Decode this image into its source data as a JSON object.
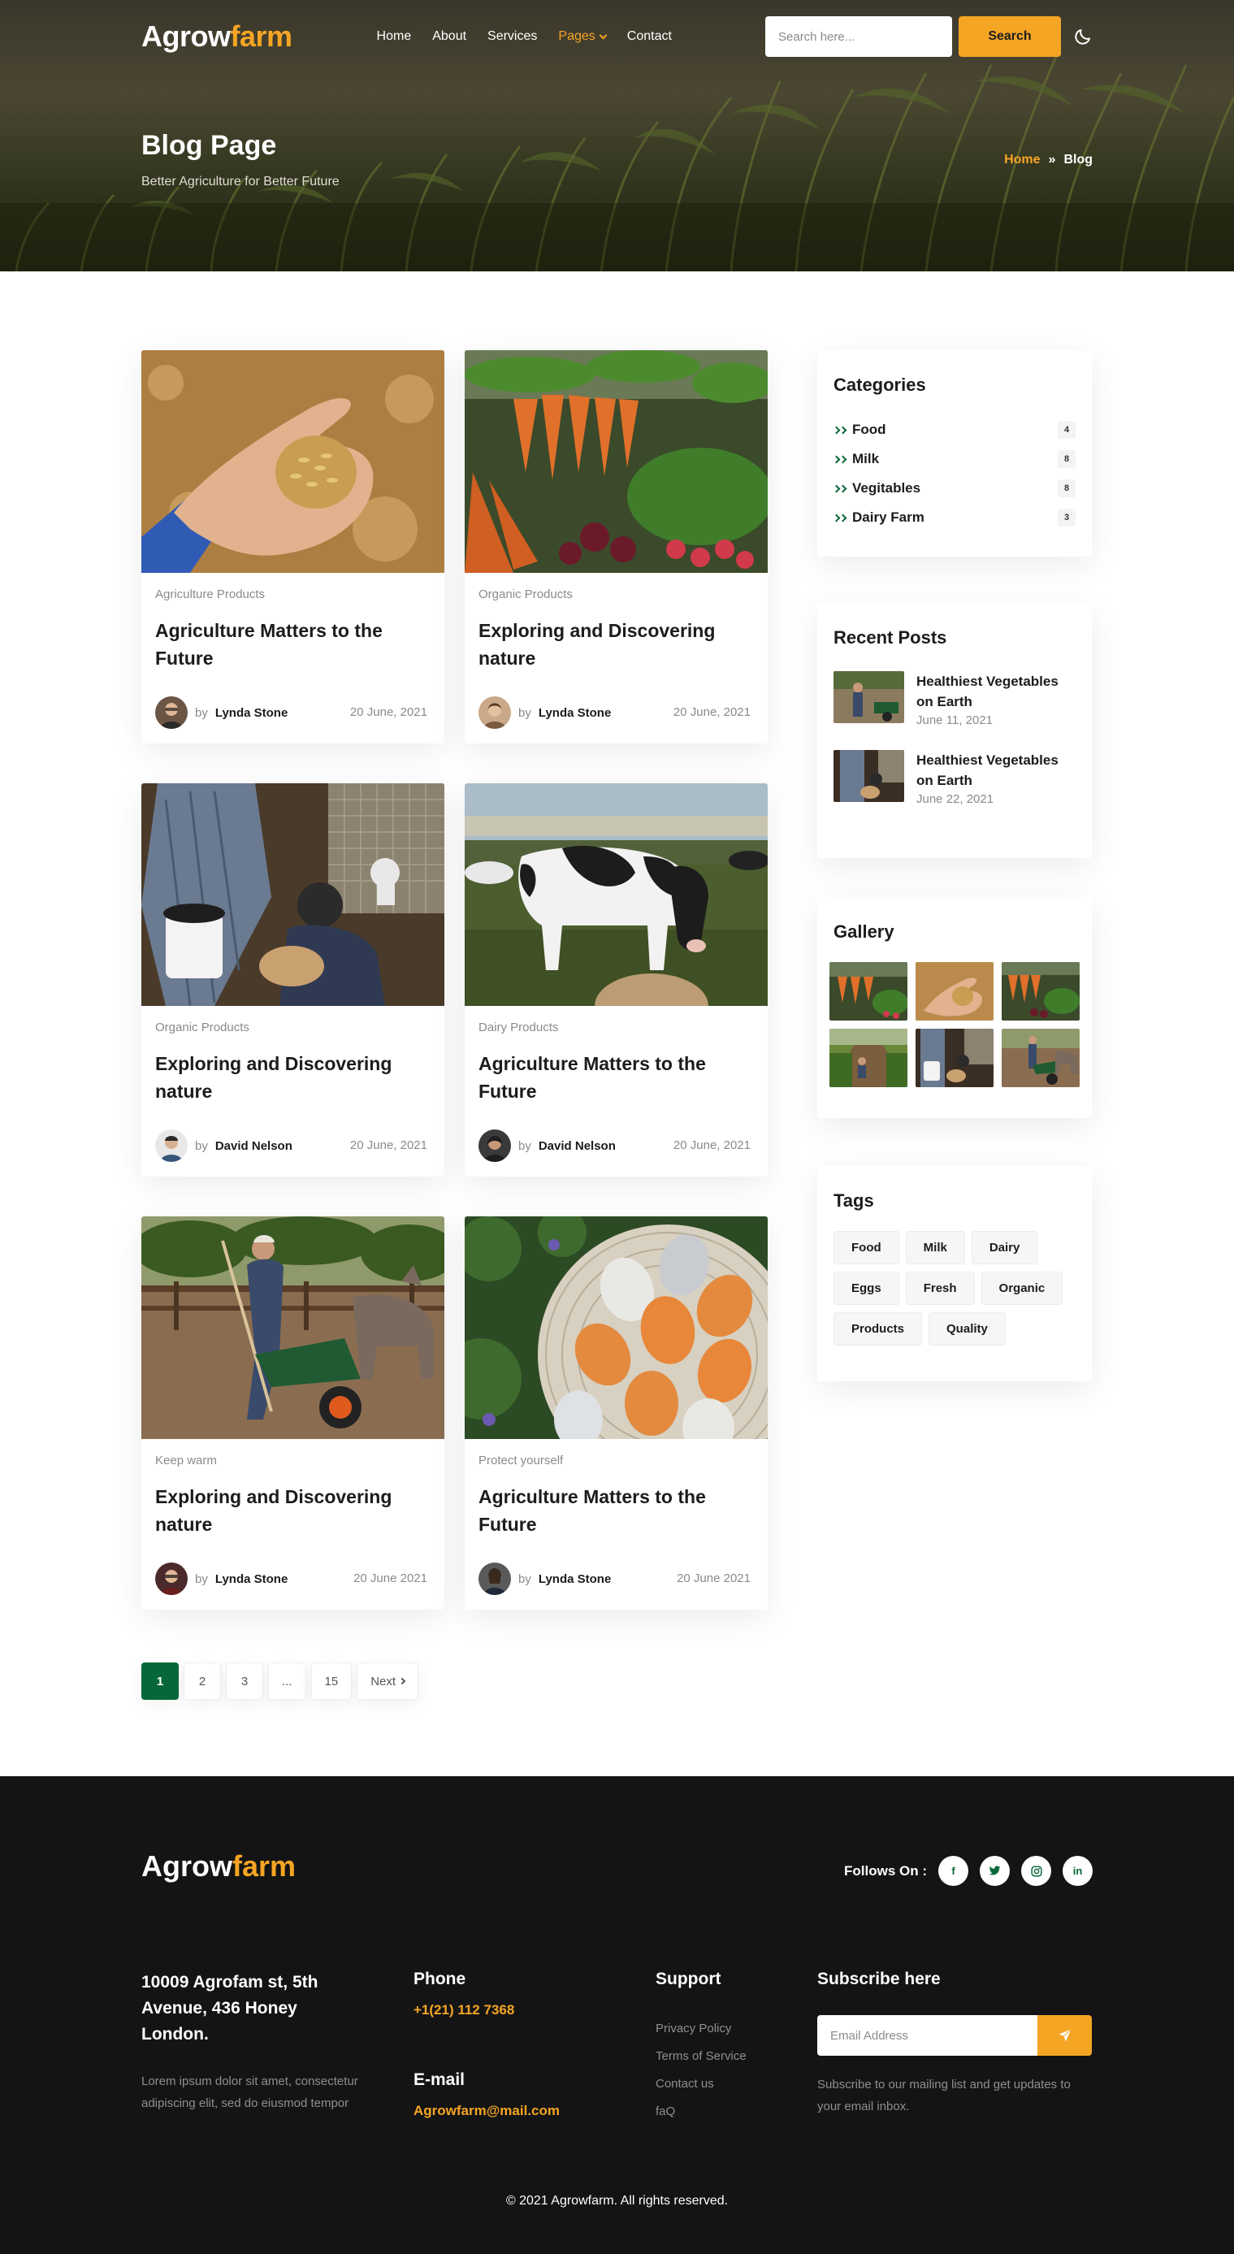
{
  "brand": {
    "name_main": "Agrow",
    "name_accent": "farm"
  },
  "nav": {
    "items": [
      {
        "label": "Home"
      },
      {
        "label": "About"
      },
      {
        "label": "Services"
      },
      {
        "label": "Pages"
      },
      {
        "label": "Contact"
      }
    ],
    "search_placeholder": "Search here...",
    "search_label": "Search",
    "theme_icon": "moon-icon"
  },
  "hero": {
    "title": "Blog Page",
    "subtitle": "Better Agriculture for Better Future",
    "breadcrumb": {
      "home": "Home",
      "separator": "»",
      "current": "Blog"
    }
  },
  "posts": [
    {
      "category": "Agriculture Products",
      "title": "Agriculture Matters to the Future",
      "by": "by",
      "author": "Lynda Stone",
      "date": "20 June, 2021",
      "image": "wheat-in-hand"
    },
    {
      "category": "Organic Products",
      "title": "Exploring and Discovering nature",
      "by": "by",
      "author": "Lynda Stone",
      "date": "20 June, 2021",
      "image": "carrots-vegetables"
    },
    {
      "category": "Organic Products",
      "title": "Exploring and Discovering nature",
      "by": "by",
      "author": "David Nelson",
      "date": "20 June, 2021",
      "image": "farmers-feeding"
    },
    {
      "category": "Dairy Products",
      "title": "Agriculture Matters to the Future",
      "by": "by",
      "author": "David Nelson",
      "date": "20 June, 2021",
      "image": "cow-in-field"
    },
    {
      "category": "Keep warm",
      "title": "Exploring and Discovering nature",
      "by": "by",
      "author": "Lynda Stone",
      "date": "20 June 2021",
      "image": "farmer-wheelbarrow"
    },
    {
      "category": "Protect yourself",
      "title": "Agriculture Matters to the Future",
      "by": "by",
      "author": "Lynda Stone",
      "date": "20 June 2021",
      "image": "eggs-basket"
    }
  ],
  "pagination": {
    "pages": [
      "1",
      "2",
      "3",
      "...",
      "15"
    ],
    "current": "1",
    "next": "Next"
  },
  "sidebar": {
    "categories": {
      "title": "Categories",
      "items": [
        {
          "label": "Food",
          "count": "4"
        },
        {
          "label": "Milk",
          "count": "8"
        },
        {
          "label": "Vegitables",
          "count": "8"
        },
        {
          "label": "Dairy Farm",
          "count": "3"
        }
      ]
    },
    "recent": {
      "title": "Recent Posts",
      "items": [
        {
          "title": "Healthiest Vegetables on Earth",
          "date": "June 11, 2021"
        },
        {
          "title": "Healthiest Vegetables on Earth",
          "date": "June 22, 2021"
        }
      ]
    },
    "gallery": {
      "title": "Gallery"
    },
    "tags": {
      "title": "Tags",
      "items": [
        "Food",
        "Milk",
        "Dairy",
        "Eggs",
        "Fresh",
        "Organic",
        "Products",
        "Quality"
      ]
    }
  },
  "footer": {
    "follow_label": "Follows On :",
    "social": [
      {
        "icon": "facebook-icon",
        "glyph": "f"
      },
      {
        "icon": "twitter-icon",
        "glyph": "t"
      },
      {
        "icon": "instagram-icon",
        "glyph": "◎"
      },
      {
        "icon": "linkedin-icon",
        "glyph": "in"
      }
    ],
    "address": "10009 Agrofam st, 5th Avenue, 436 Honey London.",
    "description": "Lorem ipsum dolor sit amet, consectetur adipiscing elit, sed do eiusmod tempor",
    "phone_title": "Phone",
    "phone": "+1(21) 112 7368",
    "email_title": "E-mail",
    "email": "Agrowfarm@mail.com",
    "support_title": "Support",
    "support_links": [
      "Privacy Policy",
      "Terms of Service",
      "Contact us",
      "faQ"
    ],
    "subscribe_title": "Subscribe here",
    "subscribe_placeholder": "Email Address",
    "subscribe_note": "Subscribe to our mailing list and get updates to your email inbox.",
    "copyright": "© 2021 Agrowfarm. All rights reserved."
  },
  "colors": {
    "accent": "#f5a524",
    "green": "#066838",
    "footer_bg": "#141414"
  }
}
